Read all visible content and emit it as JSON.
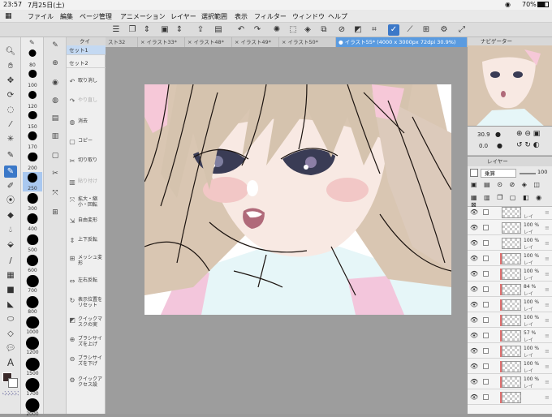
{
  "status": {
    "time": "23:57",
    "date": "7月25日(土)",
    "battery": "70%"
  },
  "menu": [
    "ファイル",
    "編集",
    "ページ管理",
    "アニメーション",
    "レイヤー",
    "選択範囲",
    "表示",
    "フィルター",
    "ウィンドウ",
    "ヘルプ"
  ],
  "tabs": [
    {
      "label": "スト32",
      "active": false
    },
    {
      "label": "イラスト33*",
      "active": false
    },
    {
      "label": "イラスト48*",
      "active": false
    },
    {
      "label": "イラスト49*",
      "active": false
    },
    {
      "label": "イラスト50*",
      "active": false
    },
    {
      "label": "イラスト55* (4000 x 3000px 72dpi 30.9%)",
      "active": true
    }
  ],
  "brush_sizes": [
    "80",
    "100",
    "120",
    "150",
    "170",
    "200",
    "250",
    "300",
    "400",
    "500",
    "600",
    "700",
    "800",
    "1000",
    "1200",
    "1500",
    "1700",
    "2000"
  ],
  "brush_selected": "250",
  "quick_access": {
    "title": "クイ",
    "sets": [
      "セット1",
      "セット2"
    ],
    "items": [
      {
        "label": "取り消し",
        "dim": false
      },
      {
        "label": "やり直し",
        "dim": true
      },
      {
        "label": "消去",
        "dim": false
      },
      {
        "label": "コピー",
        "dim": false
      },
      {
        "label": "切り取り",
        "dim": false
      },
      {
        "label": "貼り付け",
        "dim": true
      },
      {
        "label": "拡大・縮小・回転",
        "dim": false
      },
      {
        "label": "自由変形",
        "dim": false
      },
      {
        "label": "上下反転",
        "dim": false
      },
      {
        "label": "メッシュ変形",
        "dim": false
      },
      {
        "label": "左右反転",
        "dim": false
      },
      {
        "label": "表示位置をリセット",
        "dim": false
      },
      {
        "label": "クイックマスクの実",
        "dim": false
      },
      {
        "label": "ブラシサイズを上げ",
        "dim": false
      },
      {
        "label": "ブラシサイズを下げ",
        "dim": false
      },
      {
        "label": "クイックアクセス設",
        "dim": false
      }
    ]
  },
  "navigator": {
    "title": "ナビゲーター",
    "zoom": "30.9",
    "rotation": "0.0"
  },
  "layers": {
    "title": "レイヤー",
    "blend_mode": "乗算",
    "opacity": "100",
    "rows": [
      {
        "opacity": "",
        "name": "レイ",
        "mark": false
      },
      {
        "opacity": "100 %",
        "name": "レイ",
        "mark": false
      },
      {
        "opacity": "100 %",
        "name": "レイ",
        "mark": false
      },
      {
        "opacity": "100 %",
        "name": "レイ",
        "mark": true
      },
      {
        "opacity": "100 %",
        "name": "レイ",
        "mark": true
      },
      {
        "opacity": "84 %",
        "name": "レイ",
        "mark": true
      },
      {
        "opacity": "100 %",
        "name": "レイ",
        "mark": true
      },
      {
        "opacity": "100 %",
        "name": "レイ",
        "mark": true
      },
      {
        "opacity": "57 %",
        "name": "レイ",
        "mark": true
      },
      {
        "opacity": "100 %",
        "name": "レイ",
        "mark": true
      },
      {
        "opacity": "100 %",
        "name": "レイ",
        "mark": true
      },
      {
        "opacity": "100 %",
        "name": "レイ",
        "mark": true
      },
      {
        "opacity": "",
        "name": "",
        "mark": true
      }
    ]
  }
}
